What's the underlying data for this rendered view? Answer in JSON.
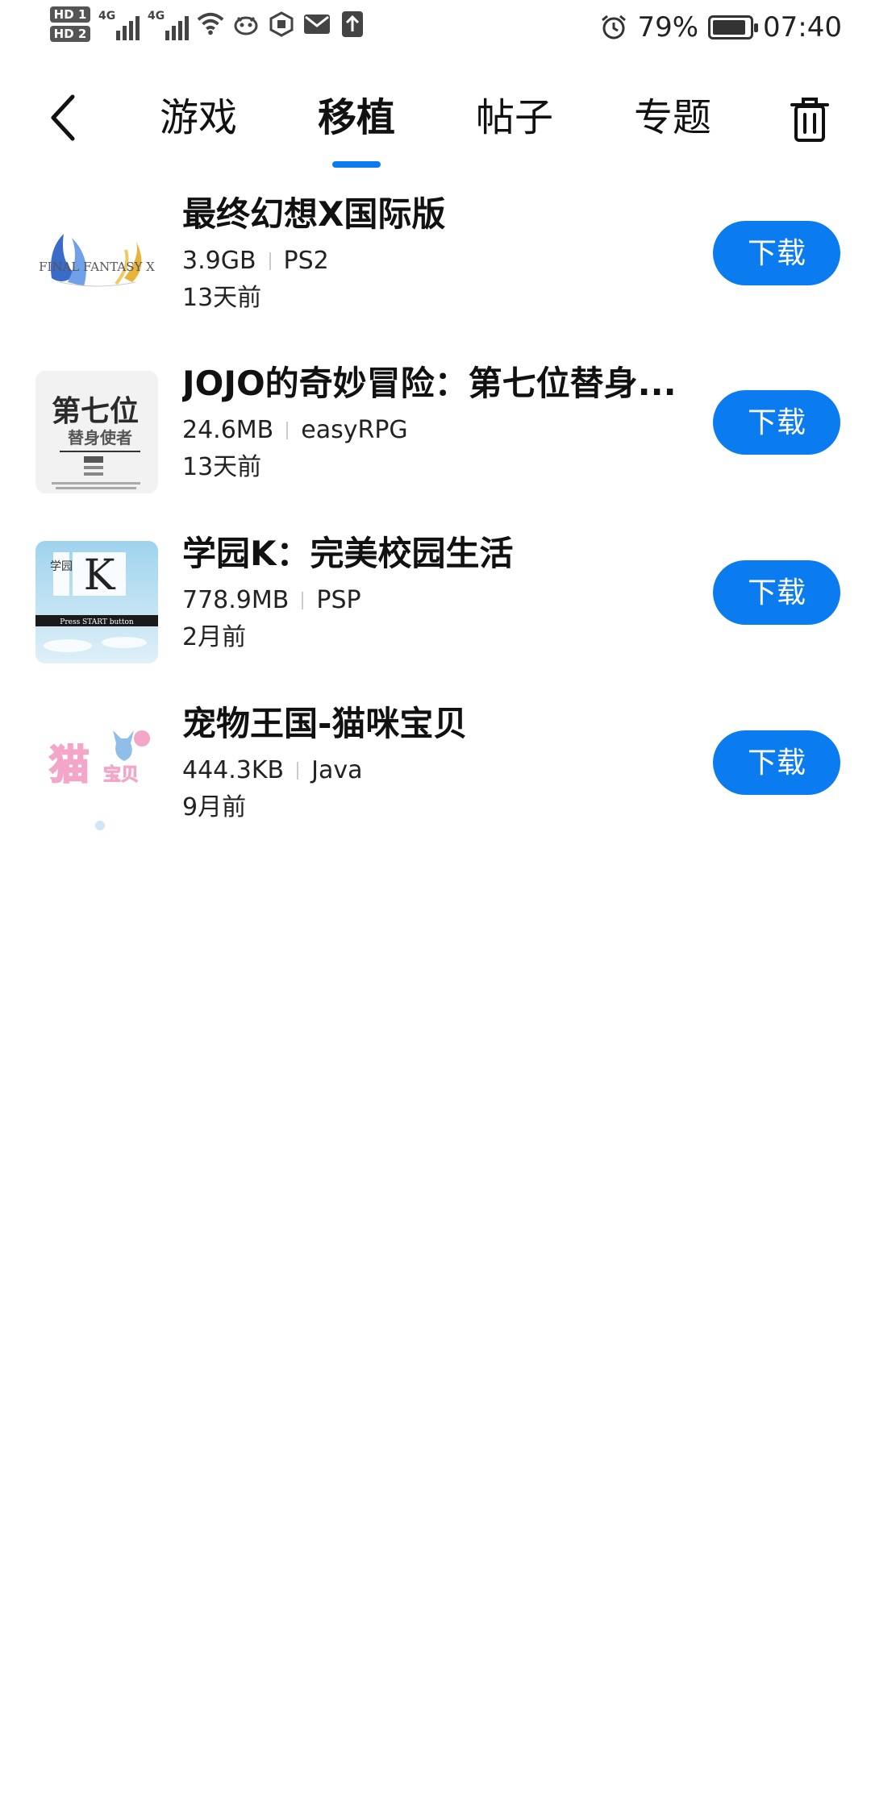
{
  "status_bar": {
    "sim1": "HD 1",
    "sim2": "HD 2",
    "net1": "4G",
    "net2": "4G",
    "battery_percent": "79%",
    "battery_level": 0.79,
    "time": "07:40",
    "icons": [
      "wifi-icon",
      "app-notification-icon",
      "shield-icon",
      "mail-icon",
      "upload-icon",
      "alarm-icon"
    ]
  },
  "nav": {
    "back_icon": "chevron-left-icon",
    "tabs": [
      {
        "label": "游戏",
        "active": false
      },
      {
        "label": "移植",
        "active": true
      },
      {
        "label": "帖子",
        "active": false
      },
      {
        "label": "专题",
        "active": false
      }
    ],
    "trash_icon": "trash-icon"
  },
  "games": [
    {
      "title": "最终幻想X国际版",
      "size": "3.9GB",
      "platform": "PS2",
      "time": "13天前",
      "button": "下载"
    },
    {
      "title": "JOJO的奇妙冒险：第七位替身...",
      "size": "24.6MB",
      "platform": "easyRPG",
      "time": "13天前",
      "button": "下载"
    },
    {
      "title": "学园K：完美校园生活",
      "size": "778.9MB",
      "platform": "PSP",
      "time": "2月前",
      "button": "下载"
    },
    {
      "title": "宠物王国-猫咪宝贝",
      "size": "444.3KB",
      "platform": "Java",
      "time": "9月前",
      "button": "下载"
    }
  ],
  "thumbnails": {
    "ffx_text": "FINAL FANTASY X",
    "jojo_text": "第七位",
    "jojo_sub": "替身使者",
    "k_text": "K",
    "k_side": "学园",
    "k_press": "Press START button",
    "cat_text": "猫",
    "cat_sub": "宝贝"
  },
  "colors": {
    "accent": "#0a7cf0",
    "text": "#111111",
    "muted": "#222222",
    "separator": "#cccccc"
  }
}
